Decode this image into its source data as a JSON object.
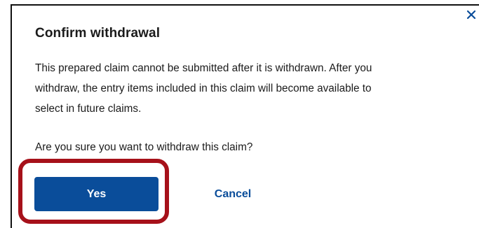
{
  "dialog": {
    "title": "Confirm withdrawal",
    "body_lines": [
      "This prepared claim cannot be submitted after it is withdrawn. After you",
      "withdraw, the entry items included in this claim will become available to",
      "select in future claims."
    ],
    "question": "Are you sure you want to withdraw this claim?",
    "close_icon": "close-icon",
    "buttons": {
      "yes_label": "Yes",
      "cancel_label": "Cancel"
    }
  },
  "colors": {
    "primary": "#0a4d9a",
    "text": "#1b1b1b",
    "highlight": "#a6111a"
  }
}
